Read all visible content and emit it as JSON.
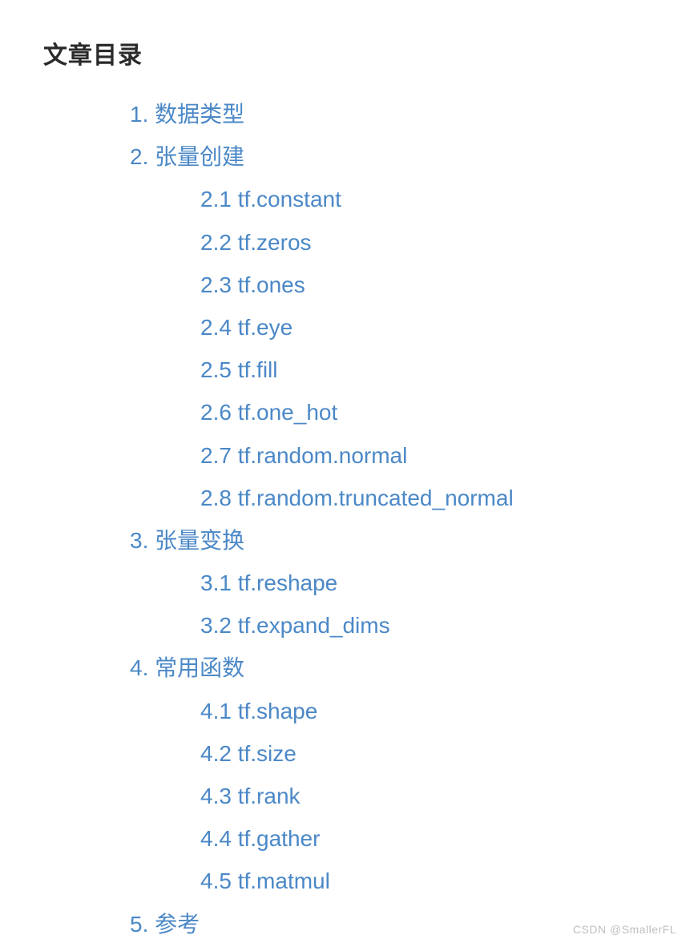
{
  "heading": "文章目录",
  "toc": [
    {
      "level": 1,
      "label": "1. 数据类型"
    },
    {
      "level": 1,
      "label": "2. 张量创建"
    },
    {
      "level": 2,
      "label": "2.1 tf.constant"
    },
    {
      "level": 2,
      "label": "2.2 tf.zeros"
    },
    {
      "level": 2,
      "label": "2.3 tf.ones"
    },
    {
      "level": 2,
      "label": "2.4 tf.eye"
    },
    {
      "level": 2,
      "label": "2.5 tf.fill"
    },
    {
      "level": 2,
      "label": "2.6 tf.one_hot"
    },
    {
      "level": 2,
      "label": "2.7 tf.random.normal"
    },
    {
      "level": 2,
      "label": "2.8 tf.random.truncated_normal"
    },
    {
      "level": 1,
      "label": "3. 张量变换"
    },
    {
      "level": 2,
      "label": "3.1 tf.reshape"
    },
    {
      "level": 2,
      "label": "3.2 tf.expand_dims"
    },
    {
      "level": 1,
      "label": "4. 常用函数"
    },
    {
      "level": 2,
      "label": "4.1 tf.shape"
    },
    {
      "level": 2,
      "label": "4.2 tf.size"
    },
    {
      "level": 2,
      "label": "4.3 tf.rank"
    },
    {
      "level": 2,
      "label": "4.4 tf.gather"
    },
    {
      "level": 2,
      "label": "4.5 tf.matmul"
    },
    {
      "level": 1,
      "label": "5. 参考"
    }
  ],
  "watermark": "CSDN @SmallerFL"
}
